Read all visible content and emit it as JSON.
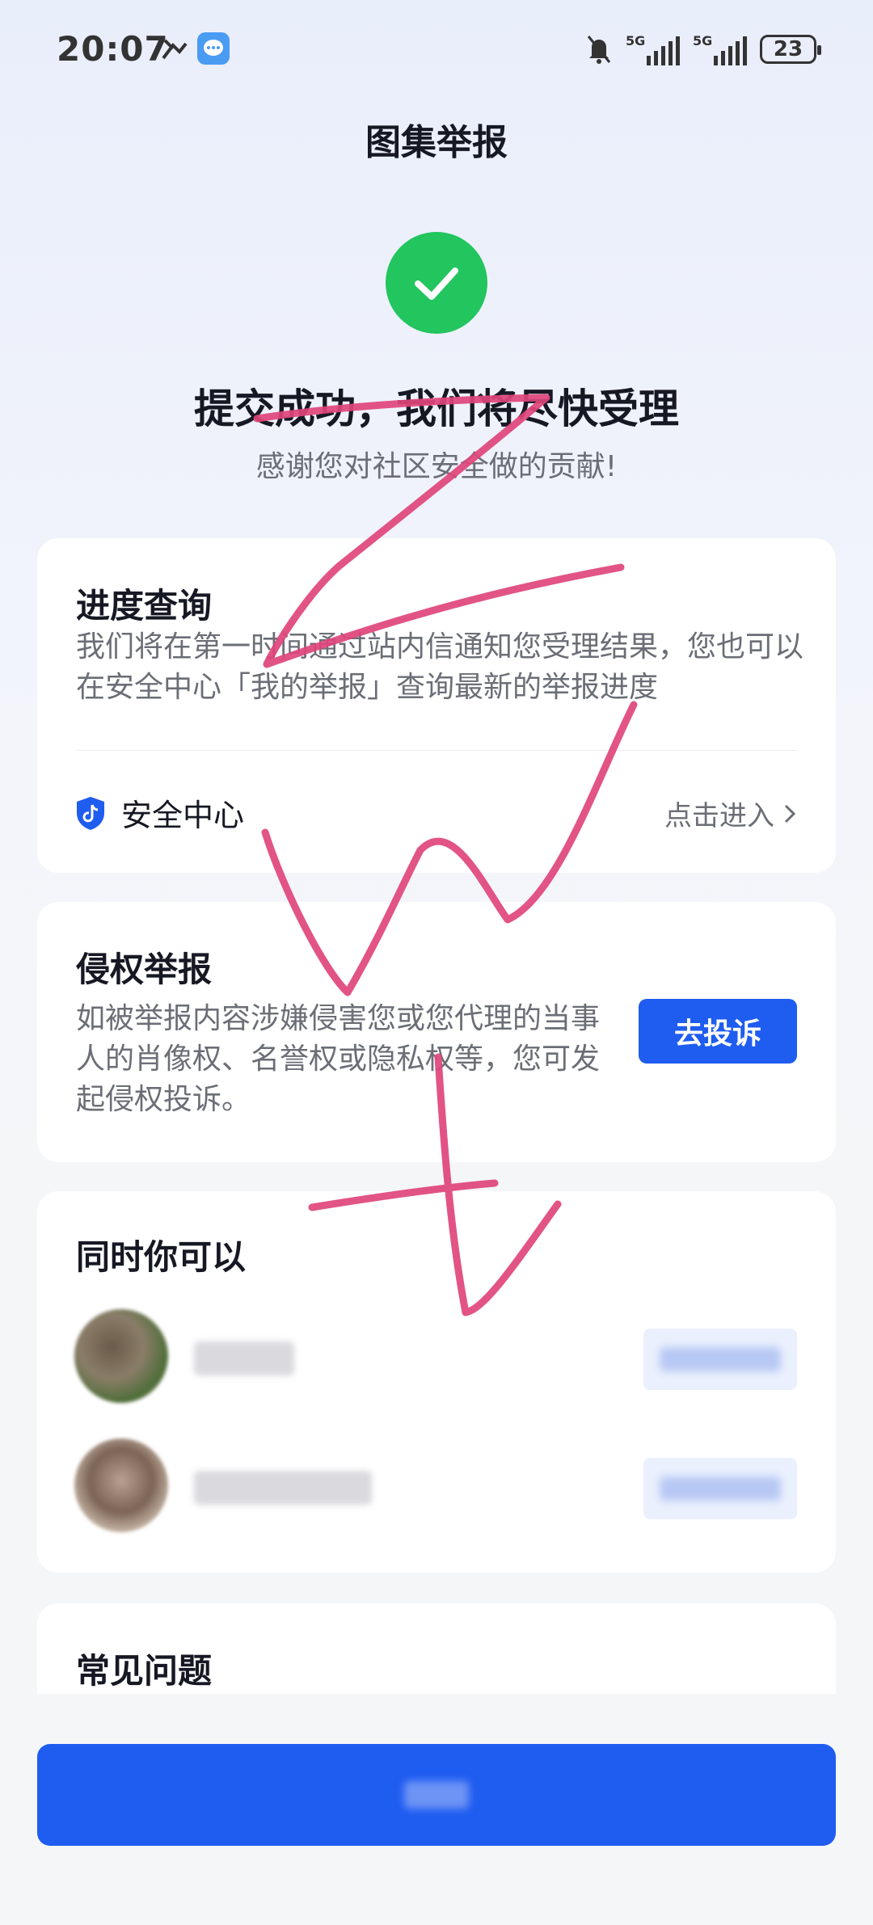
{
  "status_bar": {
    "time": "20:07",
    "network_1": "5G",
    "network_2": "5G",
    "battery": "23"
  },
  "header": {
    "title": "图集举报"
  },
  "success": {
    "title": "提交成功，我们将尽快受理",
    "subtitle": "感谢您对社区安全做的贡献!"
  },
  "progress": {
    "title": "进度查询",
    "description": "我们将在第一时间通过站内信通知您受理结果，您也可以在安全中心「我的举报」查询最新的举报进度",
    "security_center": "安全中心",
    "enter_link": "点击进入"
  },
  "infringement": {
    "title": "侵权举报",
    "description": "如被举报内容涉嫌侵害您或您代理的当事人的肖像权、名誉权或隐私权等，您可发起侵权投诉。",
    "button": "去投诉"
  },
  "also": {
    "title": "同时你可以"
  },
  "faq": {
    "title": "常见问题"
  },
  "colors": {
    "accent": "#1f5cf0",
    "success": "#22c55e",
    "scribble": "#e0457b"
  }
}
